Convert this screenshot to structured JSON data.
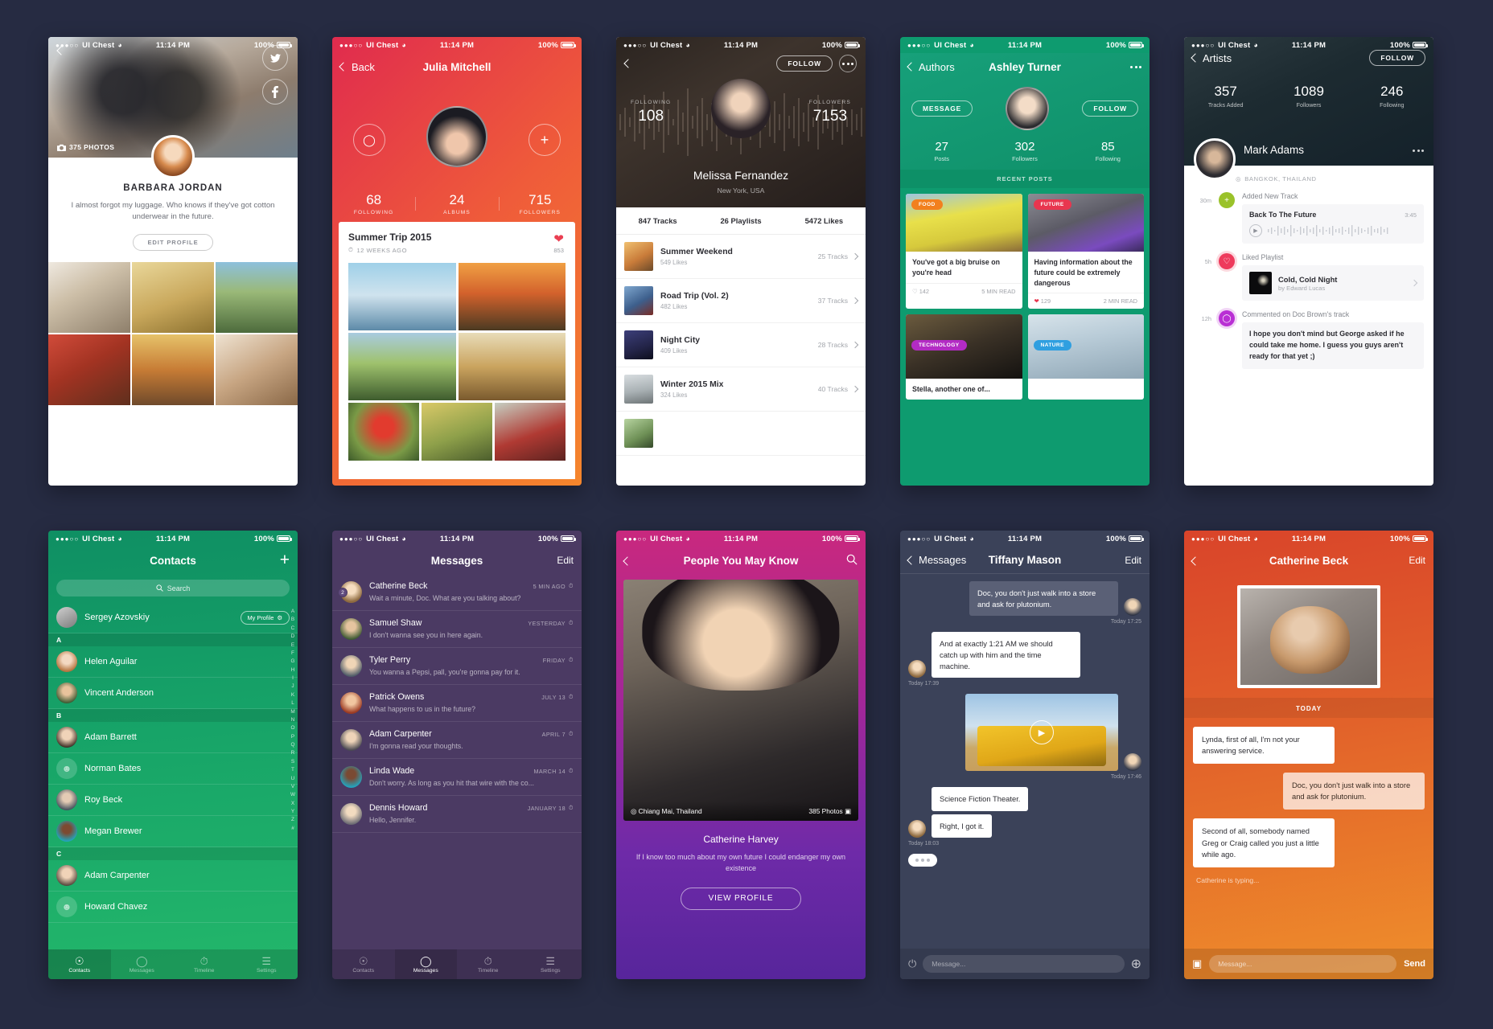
{
  "status_bar": {
    "dots": "●●●○○",
    "carrier": "UI Chest",
    "wifi": "◥",
    "time": "11:14 PM",
    "battery": "100%"
  },
  "screen1": {
    "photos_count": "375 PHOTOS",
    "name": "BARBARA JORDAN",
    "bio": "I almost forgot my luggage. Who knows if they've got cotton underwear in the future.",
    "edit_label": "EDIT PROFILE",
    "social": [
      "twitter-icon",
      "facebook-icon"
    ]
  },
  "screen2": {
    "back": "Back",
    "title": "Julia Mitchell",
    "stats": [
      {
        "n": "68",
        "l": "FOLLOWING"
      },
      {
        "n": "24",
        "l": "ALBUMS"
      },
      {
        "n": "715",
        "l": "FOLLOWERS"
      }
    ],
    "album_title": "Summer Trip 2015",
    "album_time": "12 WEEKS AGO",
    "likes": "853"
  },
  "screen3": {
    "following_label": "FOLLOWING",
    "following": "108",
    "followers_label": "FOLLOWERS",
    "followers": "7153",
    "follow_label": "FOLLOW",
    "name": "Melissa Fernandez",
    "location": "New York, USA",
    "tabs": [
      "847 Tracks",
      "26 Playlists",
      "5472 Likes"
    ],
    "tracks": [
      {
        "title": "Summer Weekend",
        "likes": "549 Likes",
        "count": "25 Tracks"
      },
      {
        "title": "Road Trip (Vol. 2)",
        "likes": "482 Likes",
        "count": "37 Tracks"
      },
      {
        "title": "Night City",
        "likes": "409 Likes",
        "count": "28 Tracks"
      },
      {
        "title": "Winter 2015 Mix",
        "likes": "324 Likes",
        "count": "40 Tracks"
      }
    ]
  },
  "screen4": {
    "back": "Authors",
    "title": "Ashley Turner",
    "message_label": "MESSAGE",
    "follow_label": "FOLLOW",
    "stats": [
      {
        "n": "27",
        "l": "Posts"
      },
      {
        "n": "302",
        "l": "Followers"
      },
      {
        "n": "85",
        "l": "Following"
      }
    ],
    "recent_label": "RECENT POSTS",
    "posts": [
      {
        "tag": "FOOD",
        "tag_color": "#f2801e",
        "text": "You've got a big bruise on you're head",
        "likes": "142",
        "read": "5 MIN READ",
        "liked": false
      },
      {
        "tag": "FUTURE",
        "tag_color": "#e8364f",
        "text": "Having information about the future could be extremely dangerous",
        "likes": "129",
        "read": "2 MIN READ",
        "liked": true
      },
      {
        "tag": "TECHNOLOGY",
        "tag_color": "#b32bc4",
        "text": "Stella, another one of...",
        "likes": "",
        "read": "",
        "liked": false
      },
      {
        "tag": "NATURE",
        "tag_color": "#2f9fe0",
        "text": "",
        "likes": "",
        "read": "",
        "liked": false
      }
    ]
  },
  "screen5": {
    "back": "Artists",
    "follow_label": "FOLLOW",
    "stats": [
      {
        "n": "357",
        "l": "Tracks Added"
      },
      {
        "n": "1089",
        "l": "Followers"
      },
      {
        "n": "246",
        "l": "Following"
      }
    ],
    "name": "Mark Adams",
    "location": "BANGKOK, THAILAND",
    "feed": [
      {
        "time": "30m",
        "icon": "plus-icon",
        "color": "#9ac22a",
        "label": "Added New Track",
        "track": "Back To The Future",
        "duration": "3:45"
      },
      {
        "time": "5h",
        "icon": "heart-icon",
        "color": "#ee3a5c",
        "label": "Liked Playlist",
        "playlist": "Cold, Cold Night",
        "by": "by Edward Lucas"
      },
      {
        "time": "12h",
        "icon": "comment-icon",
        "color": "#b92fd4",
        "label": "Commented on Doc Brown's track",
        "comment": "I hope you don't mind but George asked if he could take me home. I guess you guys aren't ready for that yet ;)"
      }
    ]
  },
  "screen6": {
    "title": "Contacts",
    "add_label": "+",
    "search_placeholder": "Search",
    "me": {
      "name": "Sergey Azovskiy",
      "my_profile": "My Profile"
    },
    "sections": [
      {
        "letter": "A",
        "people": [
          "Helen Aguilar",
          "Vincent Anderson"
        ]
      },
      {
        "letter": "B",
        "people": [
          "Adam Barrett",
          "Norman Bates",
          "Roy Beck",
          "Megan Brewer"
        ]
      },
      {
        "letter": "C",
        "people": [
          "Adam Carpenter",
          "Howard Chavez"
        ]
      }
    ],
    "index": [
      "A",
      "B",
      "C",
      "D",
      "E",
      "F",
      "G",
      "H",
      "I",
      "J",
      "K",
      "L",
      "M",
      "N",
      "O",
      "P",
      "Q",
      "R",
      "S",
      "T",
      "U",
      "V",
      "W",
      "X",
      "Y",
      "Z",
      "#"
    ],
    "tabs": [
      {
        "label": "Contacts",
        "icon": "contacts-icon",
        "active": true
      },
      {
        "label": "Messages",
        "icon": "messages-icon",
        "active": false
      },
      {
        "label": "Timeline",
        "icon": "timeline-icon",
        "active": false
      },
      {
        "label": "Settings",
        "icon": "settings-icon",
        "active": false
      }
    ]
  },
  "screen7": {
    "title": "Messages",
    "edit": "Edit",
    "threads": [
      {
        "name": "Catherine Beck",
        "preview": "Wait a minute, Doc. What are you talking about?",
        "time": "5 MIN AGO",
        "badge": "2"
      },
      {
        "name": "Samuel Shaw",
        "preview": "I don't wanna see you in here again.",
        "time": "YESTERDAY",
        "badge": ""
      },
      {
        "name": "Tyler Perry",
        "preview": "You wanna a Pepsi, pall, you're gonna pay for it.",
        "time": "FRIDAY",
        "badge": ""
      },
      {
        "name": "Patrick Owens",
        "preview": "What happens to us in the future?",
        "time": "JULY 13",
        "badge": ""
      },
      {
        "name": "Adam Carpenter",
        "preview": "I'm gonna read your thoughts.",
        "time": "APRIL 7",
        "badge": ""
      },
      {
        "name": "Linda Wade",
        "preview": "Don't worry. As long as you hit that wire with the co...",
        "time": "MARCH 14",
        "badge": ""
      },
      {
        "name": "Dennis Howard",
        "preview": "Hello, Jennifer.",
        "time": "JANUARY 18",
        "badge": ""
      }
    ],
    "tabs": [
      {
        "label": "Contacts",
        "icon": "contacts-icon",
        "active": false
      },
      {
        "label": "Messages",
        "icon": "messages-icon",
        "active": true
      },
      {
        "label": "Timeline",
        "icon": "timeline-icon",
        "active": false
      },
      {
        "label": "Settings",
        "icon": "settings-icon",
        "active": false
      }
    ]
  },
  "screen8": {
    "title": "People You May Know",
    "location": "Chiang Mai, Thailand",
    "photos": "385 Photos",
    "name": "Catherine Harvey",
    "bio": "If I know too much about my own future I could endanger my own existence",
    "button": "VIEW PROFILE"
  },
  "screen9": {
    "back": "Messages",
    "title": "Tiffany Mason",
    "edit": "Edit",
    "messages": [
      {
        "side": "out",
        "text": "Doc, you don't just walk into a store and ask for plutonium.",
        "stamp": "Today 17:25",
        "type": "text"
      },
      {
        "side": "in",
        "text": "And at exactly 1:21 AM we should catch up with him and the time machine.",
        "stamp": "Today 17:39",
        "type": "text"
      },
      {
        "side": "out",
        "text": "",
        "stamp": "Today 17:46",
        "type": "video"
      },
      {
        "side": "in",
        "text": "Science Fiction Theater.",
        "stamp": "",
        "type": "text"
      },
      {
        "side": "in",
        "text": "Right, I got it.",
        "stamp": "Today 18:03",
        "type": "text"
      },
      {
        "side": "in",
        "text": "",
        "stamp": "",
        "type": "typing"
      }
    ],
    "input_placeholder": "Message..."
  },
  "screen10": {
    "back": "",
    "title": "Catherine Beck",
    "edit": "Edit",
    "today_label": "TODAY",
    "messages": [
      {
        "side": "in",
        "text": "Lynda, first of all, I'm not your answering service."
      },
      {
        "side": "out",
        "text": "Doc, you don't just walk into a store and ask for plutonium."
      },
      {
        "side": "in",
        "text": "Second of all, somebody named Greg or Craig called you just a little while ago."
      }
    ],
    "typing_status": "Catherine is typing...",
    "input_placeholder": "Message...",
    "send_label": "Send"
  }
}
